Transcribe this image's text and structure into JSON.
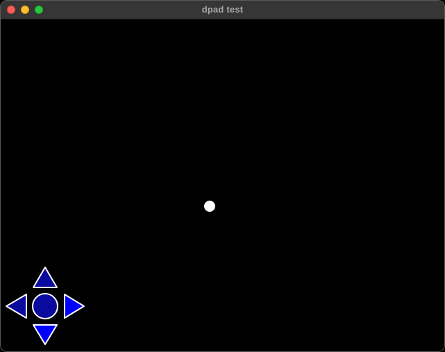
{
  "window": {
    "title": "dpad test"
  },
  "ball": {
    "color": "#ffffff"
  },
  "dpad": {
    "fill_up": "#0a0a9e",
    "fill_down": "#0000ff",
    "fill_left": "#0a0a9e",
    "fill_right": "#0000ff",
    "fill_center": "#0a0a9e",
    "stroke": "#ffffff"
  }
}
